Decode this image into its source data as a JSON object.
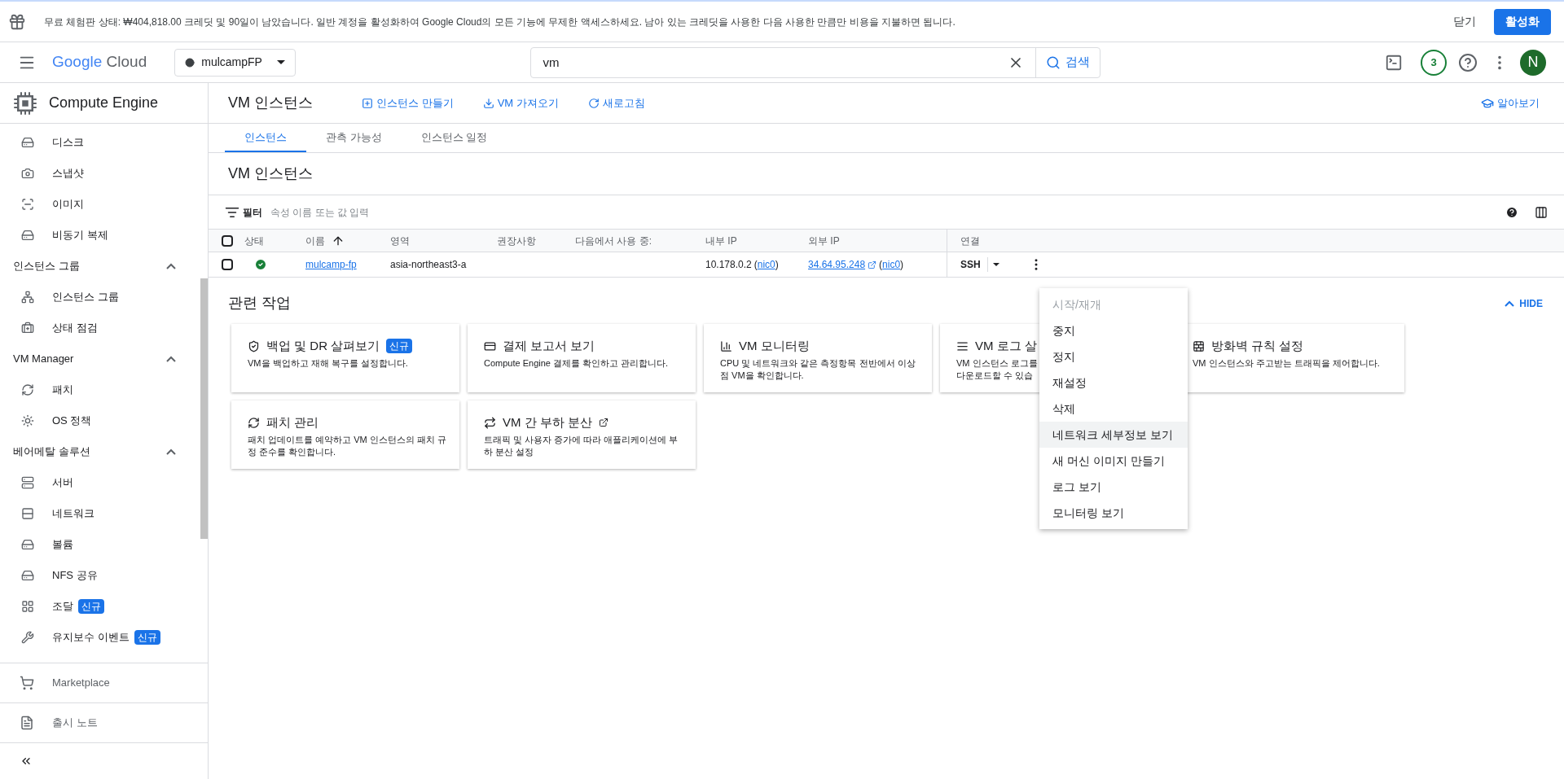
{
  "banner": {
    "text": "무료 체험판 상태: ₩404,818.00 크레딧 및 90일이 남았습니다. 일반 계정을 활성화하여 Google Cloud의 모든 기능에 무제한 액세스하세요. 남아 있는 크레딧을 사용한 다음 사용한 만큼만 비용을 지불하면 됩니다.",
    "dismiss": "닫기",
    "activate": "활성화"
  },
  "header": {
    "logo_google": "Google",
    "logo_cloud": "Cloud",
    "project": "mulcampFP",
    "search": {
      "value": "vm",
      "button": "검색"
    },
    "notifications": "3",
    "avatar": "N"
  },
  "sidebar": {
    "title": "Compute Engine",
    "items": [
      {
        "kind": "item",
        "label": "디스크"
      },
      {
        "kind": "item",
        "label": "스냅샷"
      },
      {
        "kind": "item",
        "label": "이미지"
      },
      {
        "kind": "item",
        "label": "비동기 복제"
      },
      {
        "kind": "section",
        "label": "인스턴스 그룹",
        "expanded": true
      },
      {
        "kind": "item",
        "label": "인스턴스 그룹"
      },
      {
        "kind": "item",
        "label": "상태 점검"
      },
      {
        "kind": "section",
        "label": "VM Manager",
        "expanded": true
      },
      {
        "kind": "item",
        "label": "패치"
      },
      {
        "kind": "item",
        "label": "OS 정책"
      },
      {
        "kind": "section",
        "label": "베어메탈 솔루션",
        "expanded": true
      },
      {
        "kind": "item",
        "label": "서버"
      },
      {
        "kind": "item",
        "label": "네트워크"
      },
      {
        "kind": "item",
        "label": "볼륨"
      },
      {
        "kind": "item",
        "label": "NFS 공유"
      },
      {
        "kind": "item",
        "label": "조달",
        "badge": "신규"
      },
      {
        "kind": "item",
        "label": "유지보수 이벤트",
        "badge": "신규"
      }
    ],
    "footer": [
      {
        "label": "Marketplace"
      },
      {
        "label": "출시 노트"
      }
    ]
  },
  "page": {
    "title": "VM 인스턴스",
    "actions": [
      "인스턴스 만들기",
      "VM 가져오기",
      "새로고침"
    ],
    "learn": "알아보기",
    "tabs": [
      {
        "label": "인스턴스",
        "selected": true
      },
      {
        "label": "관측 가능성",
        "selected": false
      },
      {
        "label": "인스턴스 일정",
        "selected": false
      }
    ]
  },
  "instances": {
    "title": "VM 인스턴스",
    "filter": {
      "label": "필터",
      "placeholder": "속성 이름 또는 값 입력"
    },
    "select_all_checked": false,
    "columns": [
      "상태",
      "이름",
      "영역",
      "권장사항",
      "다음에서 사용 중:",
      "내부 IP",
      "외부 IP",
      "연결"
    ],
    "rows": [
      {
        "checked": false,
        "name": "mulcamp-fp",
        "zone": "asia-northeast3-a",
        "internal_ip": "10.178.0.2",
        "internal_nic": {
          "open": "(",
          "label": "nic0",
          "close": ")"
        },
        "external_ip": "34.64.95.248",
        "external_nic": {
          "open": "(",
          "label": "nic0",
          "close": ")"
        },
        "connect": "SSH"
      }
    ]
  },
  "related": {
    "title": "관련 작업",
    "hide": "HIDE",
    "expanded": true,
    "cards": [
      {
        "title": "백업 및 DR 살펴보기",
        "badge": "신규",
        "desc": "VM을 백업하고 재해 복구를 설정합니다."
      },
      {
        "title": "결제 보고서 보기",
        "desc": "Compute Engine 결제를 확인하고 관리합니다."
      },
      {
        "title": "VM 모니터링",
        "desc": "CPU 및 네트워크와 같은 측정항목 전반에서 이상점 VM을 확인합니다."
      },
      {
        "title": "VM 로그 살",
        "desc": "VM 인스턴스 로그를 다운로드할 수 있습"
      },
      {
        "title": "방화벽 규칙 설정",
        "desc": "VM 인스턴스와 주고받는 트래픽을 제어합니다."
      },
      {
        "title": "패치 관리",
        "desc": "패치 업데이트를 예약하고 VM 인스턴스의 패치 규정 준수를 확인합니다."
      },
      {
        "title": "VM 간 부하 분산",
        "external": true,
        "desc": "트래픽 및 사용자 증가에 따라 애플리케이션에 부하 분산 설정"
      }
    ]
  },
  "menu": [
    {
      "label": "시작/재개",
      "disabled": true,
      "selected": false
    },
    {
      "label": "중지",
      "disabled": false,
      "selected": false
    },
    {
      "label": "정지",
      "disabled": false,
      "selected": false
    },
    {
      "label": "재설정",
      "disabled": false,
      "selected": false
    },
    {
      "label": "삭제",
      "disabled": false,
      "selected": false
    },
    {
      "label": "네트워크 세부정보 보기",
      "disabled": false,
      "selected": true
    },
    {
      "label": "새 머신 이미지 만들기",
      "disabled": false,
      "selected": false
    },
    {
      "label": "로그 보기",
      "disabled": false,
      "selected": false
    },
    {
      "label": "모니터링 보기",
      "disabled": false,
      "selected": false
    }
  ]
}
